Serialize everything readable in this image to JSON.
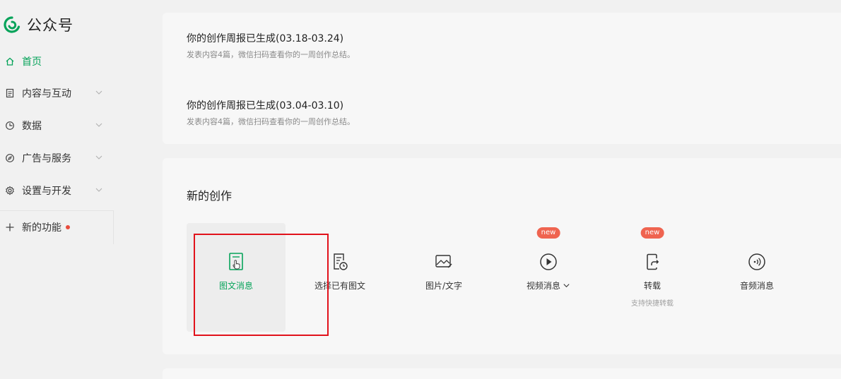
{
  "app": {
    "title": "公众号"
  },
  "sidebar": {
    "items": [
      {
        "label": "首页",
        "icon": "home-icon"
      },
      {
        "label": "内容与互动",
        "icon": "document-icon"
      },
      {
        "label": "数据",
        "icon": "pie-chart-icon"
      },
      {
        "label": "广告与服务",
        "icon": "compass-icon"
      },
      {
        "label": "设置与开发",
        "icon": "gear-icon"
      },
      {
        "label": "新的功能",
        "icon": "plus-icon"
      }
    ]
  },
  "reports": [
    {
      "title": "你的创作周报已生成(03.18-03.24)",
      "subtitle": "发表内容4篇，微信扫码查看你的一周创作总结。"
    },
    {
      "title": "你的创作周报已生成(03.04-03.10)",
      "subtitle": "发表内容4篇，微信扫码查看你的一周创作总结。"
    }
  ],
  "creation": {
    "title": "新的创作",
    "tools": [
      {
        "label": "图文消息",
        "icon": "article-icon"
      },
      {
        "label": "选择已有图文",
        "icon": "article-history-icon"
      },
      {
        "label": "图片/文字",
        "icon": "image-text-icon"
      },
      {
        "label": "视频消息",
        "icon": "play-icon",
        "badge": "new"
      },
      {
        "label": "转载",
        "icon": "repost-icon",
        "badge": "new",
        "sublabel": "支持快捷转载"
      },
      {
        "label": "音频消息",
        "icon": "audio-icon"
      }
    ]
  },
  "colors": {
    "accent": "#07a35a",
    "badge": "#ef6450",
    "highlight": "#e1121b"
  }
}
